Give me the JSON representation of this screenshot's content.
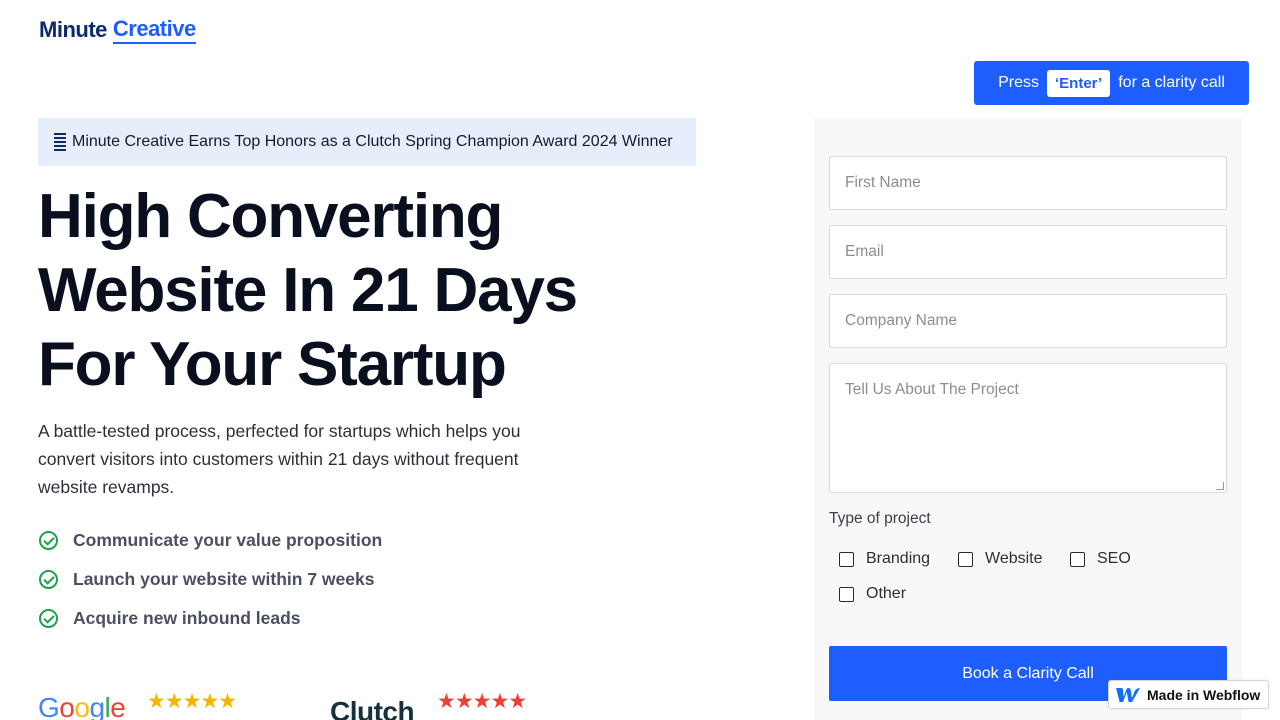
{
  "logo": {
    "part1": "Minute",
    "part2": "Creative"
  },
  "top_cta": {
    "prefix": "Press",
    "key": "‘Enter’",
    "suffix": "for a clarity call"
  },
  "award": {
    "text": "Minute Creative Earns Top Honors as a Clutch Spring Champion Award 2024 Winner"
  },
  "hero": {
    "headline_lines": [
      "High Converting",
      "Website In 21 Days",
      "For Your Startup"
    ],
    "subtext": "A battle-tested process, perfected for startups which helps you convert visitors into customers within 21 days without frequent website revamps."
  },
  "benefits": [
    "Communicate your value proposition",
    "Launch your website within 7 weeks",
    "Acquire new inbound leads"
  ],
  "ratings": {
    "google": {
      "logo_letters": [
        "G",
        "o",
        "o",
        "g",
        "l",
        "e"
      ],
      "stars": "★★★★★"
    },
    "clutch": {
      "logo": "Clutch",
      "stars": "★★★★★"
    }
  },
  "form": {
    "first_name_placeholder": "First Name",
    "email_placeholder": "Email",
    "company_placeholder": "Company Name",
    "project_placeholder": "Tell Us About The Project",
    "type_label": "Type of project",
    "options": [
      "Branding",
      "Website",
      "SEO",
      "Other"
    ],
    "submit_label": "Book a Clarity Call"
  },
  "badge": {
    "text": "Made in Webflow"
  },
  "colors": {
    "accent": "#1e5eff",
    "navy": "#0f2a6b",
    "check": "#1aa34a"
  }
}
